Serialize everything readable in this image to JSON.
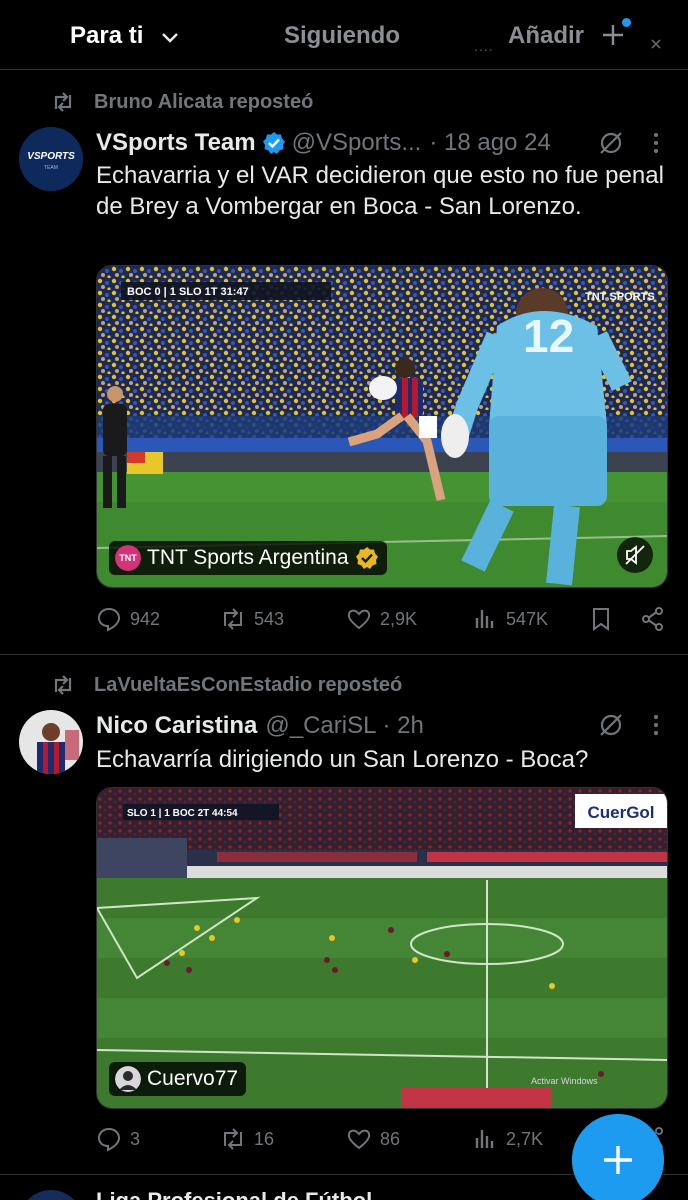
{
  "tabs": {
    "for_you": "Para ti",
    "following": "Siguiendo",
    "add": "Añadir"
  },
  "posts": [
    {
      "repost_by": "Bruno Alicata reposteó",
      "author": "VSports Team",
      "handle": "@VSports...",
      "time": "· 18 ago 24",
      "text": "Echavarria y el VAR decidieron que esto no fue penal de Brey a Vombergar en Boca - San Lorenzo.",
      "avatar_text": "VSPORTS",
      "avatar_sub": "TEAM",
      "media": {
        "scoreboard": "BOC 0 | 1 SLO  1T  31:47",
        "broadcaster_tag": "TNT SPORTS",
        "source_logo_text": "TNT",
        "source": "TNT Sports Argentina"
      },
      "stats": {
        "replies": "942",
        "reposts": "543",
        "likes": "2,9K",
        "views": "547K"
      }
    },
    {
      "repost_by": "LaVueltaEsConEstadio reposteó",
      "author": "Nico Caristina",
      "handle": "@_CariSL",
      "time": "· 2h",
      "text": "Echavarría dirigiendo un San Lorenzo - Boca?",
      "media": {
        "scoreboard": "SLO 1 | 1 BOC  2T  44:54",
        "watermark": "CuerGol",
        "source": "Cuervo77",
        "windows_note": "Activar Windows"
      },
      "stats": {
        "replies": "3",
        "reposts": "16",
        "likes": "86",
        "views": "2,7K"
      }
    }
  ],
  "next_post_peek": "Liga Profesional de Fútbol",
  "colors": {
    "accent": "#1d9bf0",
    "muted": "#71767b",
    "background": "#000000",
    "gold": "#e8b923"
  }
}
